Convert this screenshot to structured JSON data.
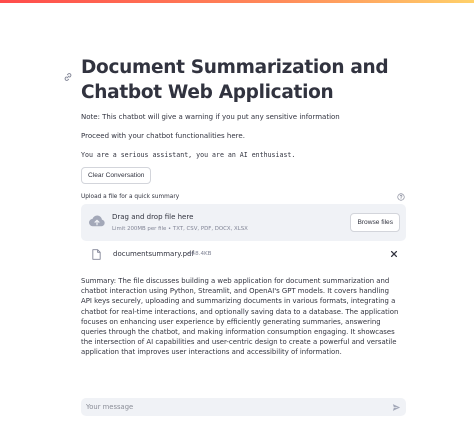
{
  "app": {
    "title": "Document Summarization and Chatbot Web Application",
    "note": "Note: This chatbot will give a warning if you put any sensitive information",
    "proceed": "Proceed with your chatbot functionalities here.",
    "system_prompt": "You are a serious assistant, you are an AI enthusiast.",
    "clear_button": "Clear Conversation"
  },
  "uploader": {
    "label": "Upload a file for a quick summary",
    "drop_title": "Drag and drop file here",
    "drop_subtitle": "Limit 200MB per file • TXT, CSV, PDF, DOCX, XLSX",
    "browse_button": "Browse files",
    "file": {
      "name": "documentsummary.pdf",
      "size": "448.4KB"
    }
  },
  "summary": "Summary: The file discusses building a web application for document summarization and chatbot interaction using Python, Streamlit, and OpenAI's GPT models. It covers handling API keys securely, uploading and summarizing documents in various formats, integrating a chatbot for real-time interactions, and optionally saving data to a database. The application focuses on enhancing user experience by efficiently generating summaries, answering queries through the chatbot, and making information consumption engaging. It showcases the intersection of AI capabilities and user-centric design to create a powerful and versatile application that improves user interactions and accessibility of information.",
  "chat": {
    "placeholder": "Your message"
  },
  "colors": {
    "accent": "#ff4b4b",
    "panel": "#f0f2f6",
    "text": "#31333f",
    "muted": "#808495"
  }
}
